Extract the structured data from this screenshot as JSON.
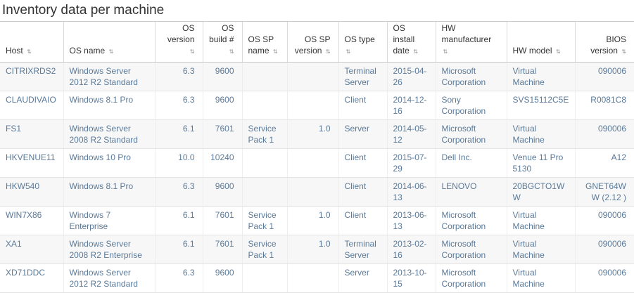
{
  "panel": {
    "title": "Inventory data per machine"
  },
  "table": {
    "columns": [
      {
        "label": "Host",
        "align": "left"
      },
      {
        "label": "OS name",
        "align": "left"
      },
      {
        "label": "OS version",
        "align": "right"
      },
      {
        "label": "OS build #",
        "align": "right"
      },
      {
        "label": "OS SP name",
        "align": "left"
      },
      {
        "label": "OS SP version",
        "align": "right"
      },
      {
        "label": "OS type",
        "align": "left"
      },
      {
        "label": "OS install date",
        "align": "left"
      },
      {
        "label": "HW manufacturer",
        "align": "left"
      },
      {
        "label": "HW model",
        "align": "left"
      },
      {
        "label": "BIOS version",
        "align": "right"
      }
    ],
    "sort_icon": "sort-arrows-icon",
    "rows": [
      [
        "CITRIXRDS2",
        "Windows Server 2012 R2 Standard",
        "6.3",
        "9600",
        "",
        "",
        "Terminal Server",
        "2015-04-26",
        "Microsoft Corporation",
        "Virtual Machine",
        "090006"
      ],
      [
        "CLAUDIVAIO",
        "Windows 8.1 Pro",
        "6.3",
        "9600",
        "",
        "",
        "Client",
        "2014-12-16",
        "Sony Corporation",
        "SVS15112C5E",
        "R0081C8"
      ],
      [
        "FS1",
        "Windows Server 2008 R2 Standard",
        "6.1",
        "7601",
        "Service Pack 1",
        "1.0",
        "Server",
        "2014-05-12",
        "Microsoft Corporation",
        "Virtual Machine",
        "090006"
      ],
      [
        "HKVENUE11",
        "Windows 10 Pro",
        "10.0",
        "10240",
        "",
        "",
        "Client",
        "2015-07-29",
        "Dell Inc.",
        "Venue 11 Pro 5130",
        "A12"
      ],
      [
        "HKW540",
        "Windows 8.1 Pro",
        "6.3",
        "9600",
        "",
        "",
        "Client",
        "2014-06-13",
        "LENOVO",
        "20BGCTO1WW",
        "GNET64WW (2.12 )"
      ],
      [
        "WIN7X86",
        "Windows 7 Enterprise",
        "6.1",
        "7601",
        "Service Pack 1",
        "1.0",
        "Client",
        "2013-06-13",
        "Microsoft Corporation",
        "Virtual Machine",
        "090006"
      ],
      [
        "XA1",
        "Windows Server 2008 R2 Enterprise",
        "6.1",
        "7601",
        "Service Pack 1",
        "1.0",
        "Terminal Server",
        "2013-02-16",
        "Microsoft Corporation",
        "Virtual Machine",
        "090006"
      ],
      [
        "XD71DDC",
        "Windows Server 2012 R2 Standard",
        "6.3",
        "9600",
        "",
        "",
        "Server",
        "2013-10-15",
        "Microsoft Corporation",
        "Virtual Machine",
        "090006"
      ]
    ]
  }
}
